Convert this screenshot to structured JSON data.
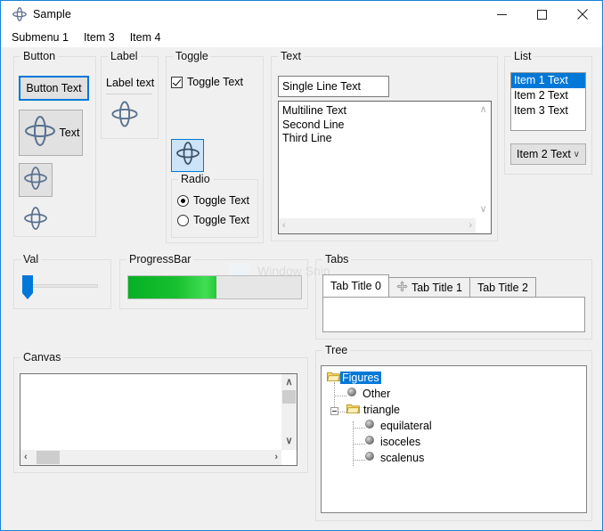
{
  "window": {
    "title": "Sample",
    "icon": "axes-icon",
    "controls": [
      {
        "name": "minimize-button",
        "glyph": "–"
      },
      {
        "name": "maximize-button",
        "glyph": "□"
      },
      {
        "name": "close-button",
        "glyph": "✕"
      }
    ]
  },
  "menubar": {
    "items": [
      "Submenu 1",
      "Item 3",
      "Item 4"
    ]
  },
  "groups": {
    "button": "Button",
    "label": "Label",
    "toggle": "Toggle",
    "radio": "Radio",
    "text": "Text",
    "list": "List",
    "val": "Val",
    "progressbar": "ProgressBar",
    "tabs": "Tabs",
    "canvas": "Canvas",
    "tree": "Tree"
  },
  "button_group": {
    "focused_button_label": "Button Text",
    "icon_text_button_label": "Text",
    "icon_button_icon": "axes-icon",
    "flat_icon_button_icon": "axes-icon"
  },
  "label_group": {
    "text": "Label text",
    "icon": "axes-icon"
  },
  "toggle_group": {
    "checkbox_label": "Toggle Text",
    "checkbox_checked": true,
    "toggle_icon_button_icon": "axes-icon",
    "toggle_icon_button_pressed": true,
    "radio_items": [
      {
        "label": "Toggle Text",
        "checked": true
      },
      {
        "label": "Toggle Text",
        "checked": false
      }
    ]
  },
  "text_group": {
    "single_line_value": "Single Line Text",
    "single_line_placeholder": "Single Line Text",
    "multiline_value": "Multiline Text\nSecond Line\nThird Line",
    "scroll_up_glyph": "∧",
    "scroll_down_glyph": "∨",
    "scroll_left_glyph": "‹",
    "scroll_right_glyph": "›"
  },
  "list_group": {
    "items": [
      "Item 1 Text",
      "Item 2 Text",
      "Item 3 Text"
    ],
    "selected_index": 0,
    "combo_value": "Item 2 Text",
    "combo_chevron": "∨"
  },
  "slider": {
    "value_percent": 5
  },
  "progress": {
    "value_percent": 51
  },
  "tabs": {
    "items": [
      {
        "label": "Tab Title 0",
        "icon": null,
        "active": true
      },
      {
        "label": "Tab Title 1",
        "icon": "move-arrows-icon",
        "active": false
      },
      {
        "label": "Tab Title 2",
        "icon": null,
        "active": false
      }
    ]
  },
  "canvas": {
    "scroll_up_glyph": "∧",
    "scroll_down_glyph": "∨",
    "scroll_left_glyph": "‹",
    "scroll_right_glyph": "›"
  },
  "tree": {
    "nodes": [
      {
        "label": "Figures",
        "type": "folder",
        "depth": 0,
        "selected": true,
        "expander": null
      },
      {
        "label": "Other",
        "type": "sphere",
        "depth": 1,
        "selected": false,
        "expander": null
      },
      {
        "label": "triangle",
        "type": "folder",
        "depth": 1,
        "selected": false,
        "expander": "minus"
      },
      {
        "label": "equilateral",
        "type": "sphere",
        "depth": 2,
        "selected": false,
        "expander": null
      },
      {
        "label": "isoceles",
        "type": "sphere",
        "depth": 2,
        "selected": false,
        "expander": null
      },
      {
        "label": "scalenus",
        "type": "sphere",
        "depth": 2,
        "selected": false,
        "expander": null
      }
    ]
  },
  "overlay": {
    "ghost_text": "Window Snip"
  },
  "colors": {
    "accent": "#0078d7",
    "window_border": "#1883d7",
    "client_bg": "#f0f0f0",
    "selection": "#0078d7",
    "progress_fill": "#13c02c",
    "folder": "#ffd24d"
  }
}
